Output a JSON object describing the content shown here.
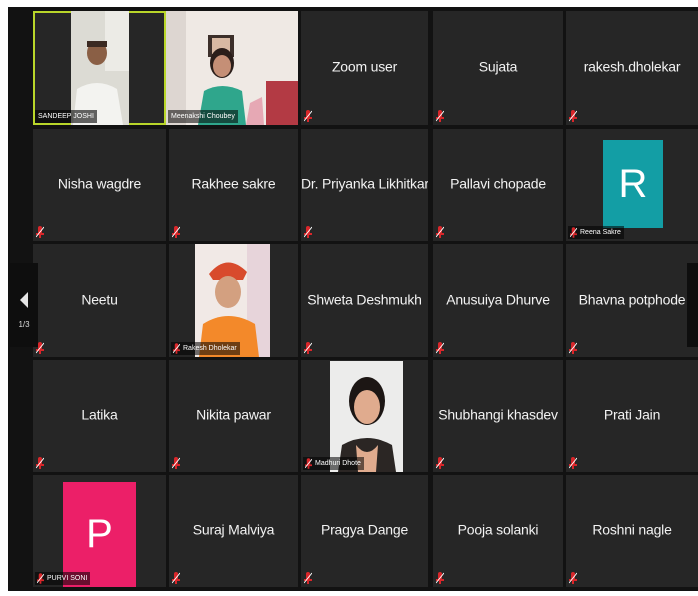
{
  "meeting": {
    "page_indicator": "1/3",
    "colors": {
      "stage_bg": "#121212",
      "tile_bg": "#262626",
      "active_speaker_border": "#b9d62a",
      "muted_icon": "#d9262a",
      "avatar_teal": "#139ea5",
      "avatar_pink": "#ec1f68"
    }
  },
  "participants": [
    {
      "name": "SANDEEP JOSHI",
      "kind": "video",
      "active_speaker": true
    },
    {
      "name": "Meenakshi Choubey",
      "kind": "video"
    },
    {
      "name": "Zoom user",
      "kind": "name",
      "muted": true
    },
    {
      "name": "Sujata",
      "kind": "name",
      "muted": true
    },
    {
      "name": "rakesh.dholekar",
      "kind": "name",
      "muted": true
    },
    {
      "name": "Nisha wagdre",
      "kind": "name",
      "muted": true
    },
    {
      "name": "Rakhee sakre",
      "kind": "name",
      "muted": true
    },
    {
      "name": "Dr. Priyanka Likhitkar",
      "kind": "name",
      "muted": true
    },
    {
      "name": "Pallavi chopade",
      "kind": "name",
      "muted": true
    },
    {
      "name": "Reena Sakre",
      "kind": "avatar",
      "initial": "R",
      "muted": true
    },
    {
      "name": "Neetu",
      "kind": "name",
      "muted": true
    },
    {
      "name": "Rakesh Dholekar",
      "kind": "video",
      "muted": true
    },
    {
      "name": "Shweta Deshmukh",
      "kind": "name",
      "muted": true
    },
    {
      "name": "Anusuiya Dhurve",
      "kind": "name",
      "muted": true
    },
    {
      "name": "Bhavna potphode",
      "kind": "name",
      "muted": true
    },
    {
      "name": "Latika",
      "kind": "name",
      "muted": true
    },
    {
      "name": "Nikita pawar",
      "kind": "name",
      "muted": true
    },
    {
      "name": "Madhuri Dhote",
      "kind": "video",
      "muted": true
    },
    {
      "name": "Shubhangi khasdev",
      "kind": "name",
      "muted": true
    },
    {
      "name": "Prati Jain",
      "kind": "name",
      "muted": true
    },
    {
      "name": "PURVI SONI",
      "kind": "avatar",
      "initial": "P",
      "muted": true
    },
    {
      "name": "Suraj Malviya",
      "kind": "name",
      "muted": true
    },
    {
      "name": "Pragya Dange",
      "kind": "name",
      "muted": true
    },
    {
      "name": "Pooja solanki",
      "kind": "name",
      "muted": true
    },
    {
      "name": "Roshni nagle",
      "kind": "name",
      "muted": true
    }
  ]
}
